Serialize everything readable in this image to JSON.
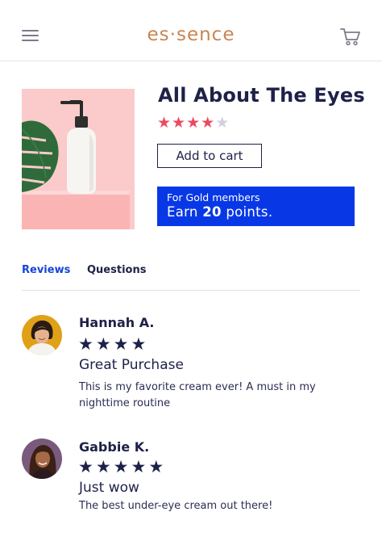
{
  "header": {
    "brand": "es·sence",
    "menu_icon": "hamburger-menu-icon",
    "cart_icon": "shopping-cart-icon"
  },
  "product": {
    "name": "All About The Eyes",
    "rating_stars": 4,
    "rating_max": 5,
    "add_to_cart_label": "Add to cart",
    "image_icon": "lotion-pump-bottle-image"
  },
  "rewards": {
    "label": "For Gold members",
    "earn_prefix": "Earn",
    "points_value": "20",
    "earn_suffix": "points."
  },
  "tabs": [
    {
      "label": "Reviews",
      "active": true
    },
    {
      "label": "Questions",
      "active": false
    }
  ],
  "reviews": [
    {
      "name": "Hannah A.",
      "stars": 4,
      "title": "Great Purchase",
      "body": "This is my favorite cream ever! A must in my nighttime routine"
    },
    {
      "name": "Gabbie K.",
      "stars": 5,
      "title": "Just wow",
      "body": "The best under-eye cream out there!"
    }
  ],
  "colors": {
    "brand": "#c98550",
    "navy": "#1e2147",
    "rating_star": "#ea4b5f",
    "gold_box": "#0838e6",
    "active_tab": "#1646d8"
  }
}
